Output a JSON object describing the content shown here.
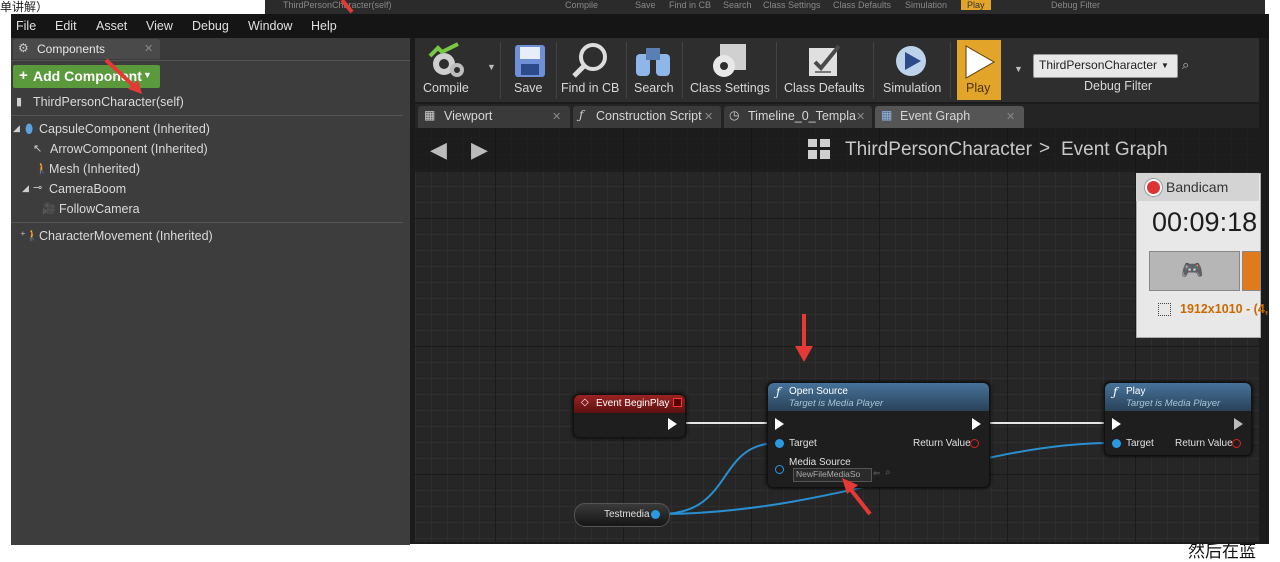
{
  "background": {
    "top_left_text": "单讲解）",
    "bottom_right_text": "然后在蓝",
    "top_strip": {
      "partial_items": [
        "ThirdPersonCharacter(self)",
        "Compile",
        "Save",
        "Find in CB",
        "Search",
        "Class Settings",
        "Class Defaults",
        "Simulation",
        "Play",
        "Debug Filter"
      ]
    }
  },
  "menubar": {
    "items": [
      "File",
      "Edit",
      "Asset",
      "View",
      "Debug",
      "Window",
      "Help"
    ]
  },
  "components_panel": {
    "tab_label": "Components",
    "add_button_label": "Add Component",
    "self_item": "ThirdPersonCharacter(self)",
    "tree": [
      {
        "label": "CapsuleComponent (Inherited)",
        "icon": "capsule-icon"
      },
      {
        "label": "ArrowComponent (Inherited)",
        "icon": "arrow-icon"
      },
      {
        "label": "Mesh (Inherited)",
        "icon": "mesh-icon"
      },
      {
        "label": "CameraBoom",
        "icon": "spring-arm-icon"
      },
      {
        "label": "FollowCamera",
        "icon": "camera-icon"
      }
    ],
    "movement_item": "CharacterMovement (Inherited)"
  },
  "toolbar": {
    "buttons": [
      {
        "label": "Compile",
        "icon": "compile-icon"
      },
      {
        "label": "Save",
        "icon": "save-icon"
      },
      {
        "label": "Find in CB",
        "icon": "find-in-cb-icon"
      },
      {
        "label": "Search",
        "icon": "search-binoculars-icon"
      },
      {
        "label": "Class Settings",
        "icon": "class-settings-icon"
      },
      {
        "label": "Class Defaults",
        "icon": "class-defaults-icon"
      },
      {
        "label": "Simulation",
        "icon": "simulation-icon"
      },
      {
        "label": "Play",
        "icon": "play-icon"
      }
    ],
    "debug_filter_value": "ThirdPersonCharacter",
    "debug_filter_label": "Debug Filter",
    "accent_play": "#e3a42a"
  },
  "tabs": [
    {
      "label": "Viewport",
      "icon": "viewport-icon"
    },
    {
      "label": "Construction Script",
      "icon": "function-icon"
    },
    {
      "label": "Timeline_0_Templa",
      "icon": "timeline-icon"
    },
    {
      "label": "Event Graph",
      "icon": "event-graph-icon",
      "active": true
    }
  ],
  "graph": {
    "breadcrumb_blueprint": "ThirdPersonCharacter",
    "breadcrumb_separator": ">",
    "breadcrumb_graph": "Event Graph",
    "nodes": {
      "event_begin_play": {
        "title": "Event BeginPlay",
        "color": "#8a1c1c"
      },
      "open_source": {
        "title": "Open Source",
        "subtitle": "Target is Media Player",
        "pin_target": "Target",
        "pin_return": "Return Value",
        "pin_media_source": "Media Source",
        "media_source_value": "NewFileMediaSo",
        "color": "#3a5c7a"
      },
      "play": {
        "title": "Play",
        "subtitle": "Target is Media Player",
        "pin_target": "Target",
        "pin_return": "Return Value",
        "color": "#3a5c7a"
      },
      "testmedia": {
        "title": "Testmedia"
      }
    }
  },
  "bandicam": {
    "title": "Bandicam",
    "timer": "00:09:18",
    "resolution": "1912x1010 - (4,"
  }
}
